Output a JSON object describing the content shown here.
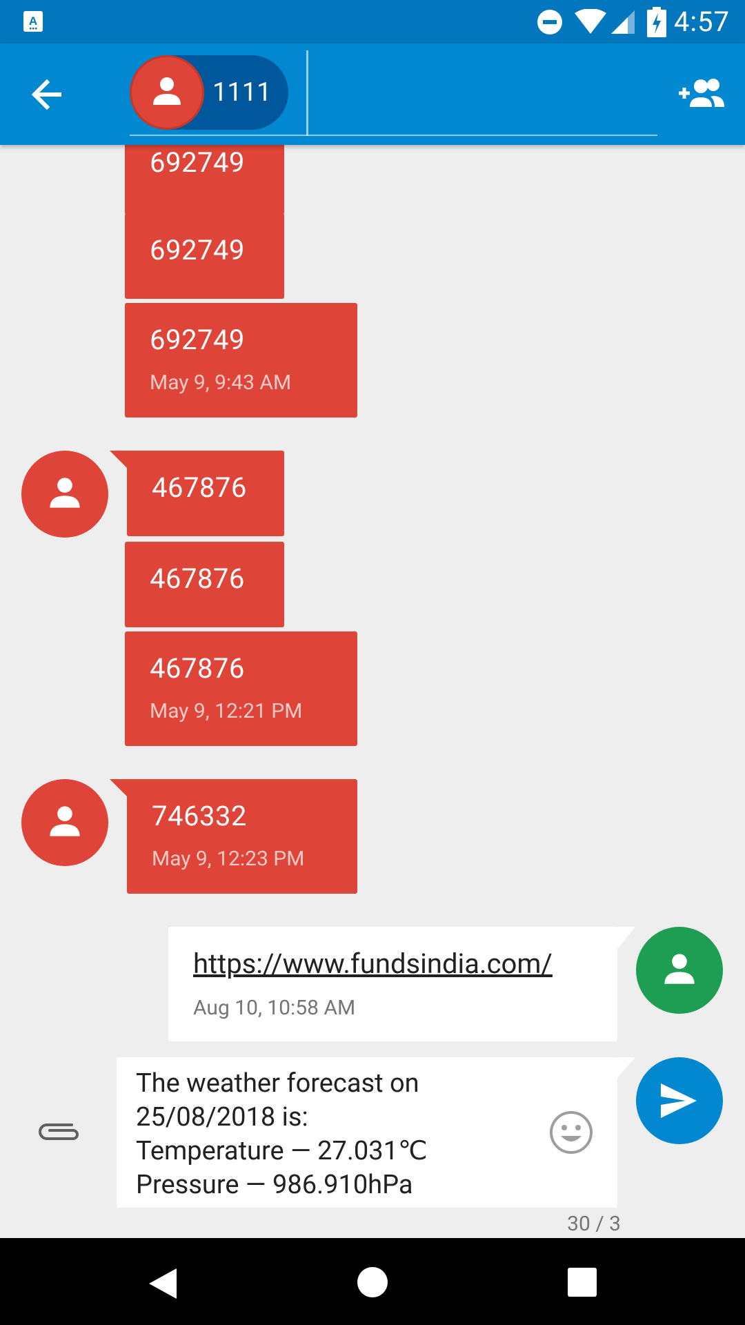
{
  "status_bar": {
    "time": "4:57",
    "icons": [
      "app-notification-icon",
      "do-not-disturb-icon",
      "wifi-icon",
      "cell-signal-icon",
      "battery-charging-icon"
    ]
  },
  "app_bar": {
    "back_icon": "arrow-back-icon",
    "recipient_chip": {
      "label": "1111",
      "icon": "person-icon"
    },
    "add_people_icon": "add-people-icon",
    "color": "#0288D1"
  },
  "thread": {
    "incoming_color": "#DE4438",
    "outgoing_avatar_color": "#1E9E53",
    "groups": [
      {
        "messages": [
          {
            "text": "692749"
          },
          {
            "text": "692749"
          },
          {
            "text": "692749",
            "timestamp": "May 9, 9:43 AM"
          }
        ]
      },
      {
        "messages": [
          {
            "text": "467876"
          },
          {
            "text": "467876"
          },
          {
            "text": "467876",
            "timestamp": "May 9, 12:21 PM"
          }
        ]
      },
      {
        "messages": [
          {
            "text": "746332",
            "timestamp": "May 9, 12:23 PM"
          }
        ]
      }
    ],
    "outgoing": {
      "text": "https://www.fundsindia.com/",
      "timestamp": "Aug 10, 10:58 AM"
    }
  },
  "composer": {
    "lines": [
      "The weather forecast on",
      "25/08/2018 is:",
      "Temperature — 27.031℃",
      "Pressure — 986.910hPa"
    ],
    "attach_icon": "paperclip-icon",
    "emoji_icon": "emoji-icon",
    "send_icon": "send-icon",
    "counter": "30 / 3"
  },
  "nav_bar": {
    "icons": [
      "nav-back-icon",
      "nav-home-icon",
      "nav-recents-icon"
    ]
  }
}
